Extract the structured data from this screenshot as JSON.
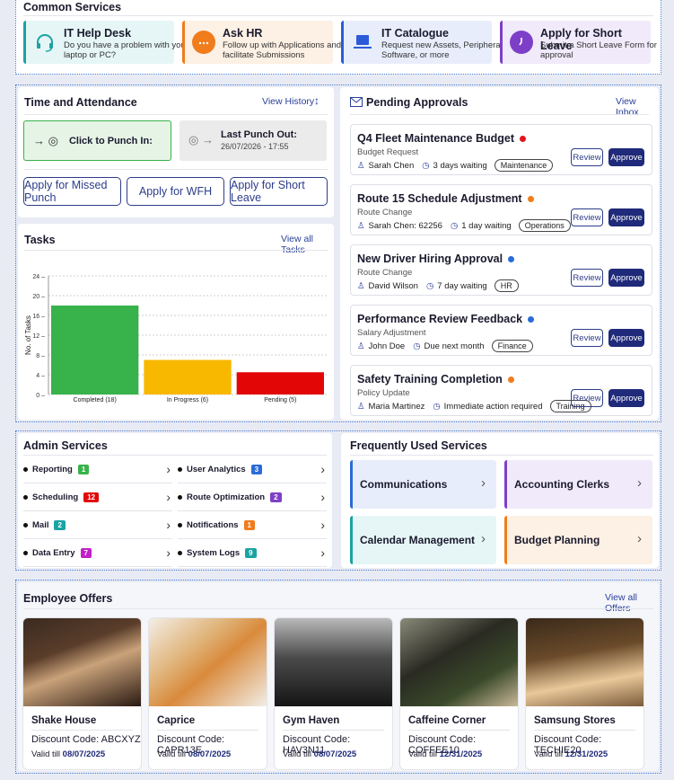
{
  "common_services": {
    "title": "Common Services",
    "items": [
      {
        "title": "IT Help Desk",
        "desc": "Do you have a problem with your laptop or PC?",
        "icon": "headset-icon",
        "color": "#1aa3a3",
        "bg": "#e6f6f6"
      },
      {
        "title": "Ask HR",
        "desc": "Follow up with Applications and facilitate Submissions",
        "icon": "chat-bubbles-icon",
        "color": "#f07c1c",
        "bg": "#fdf0e4"
      },
      {
        "title": "IT Catalogue",
        "desc": "Request new Assets, Peripherals, Software, or more",
        "icon": "laptop-icon",
        "color": "#2b5bd7",
        "bg": "#e7edfb"
      },
      {
        "title": "Apply for Short Leave",
        "desc": "Submit a Short Leave Form for approval",
        "icon": "clock-icon",
        "color": "#7e3fc8",
        "bg": "#f0eafa"
      }
    ]
  },
  "attendance": {
    "title": "Time and Attendance",
    "view_history": "View History",
    "punch_in": "Click to Punch In:",
    "last_punch_label": "Last Punch Out:",
    "last_punch_value": "26/07/2026 - 17:55",
    "buttons": [
      "Apply for Missed Punch",
      "Apply for WFH",
      "Apply for Short Leave"
    ]
  },
  "tasks": {
    "title": "Tasks",
    "view_all": "View all Tasks"
  },
  "chart_data": {
    "type": "bar",
    "categories": [
      "Completed (18)",
      "In Progress (6)",
      "Pending (5)"
    ],
    "values": [
      18,
      7,
      4.5
    ],
    "colors": [
      "#38b24a",
      "#f8b800",
      "#e30606"
    ],
    "ylabel": "No. of Tasks",
    "ylim": [
      0,
      24
    ],
    "yticks": [
      0,
      4,
      8,
      12,
      16,
      20,
      24
    ],
    "grid": true
  },
  "approvals": {
    "title": "Pending Approvals",
    "view_inbox": "View Inbox",
    "review_label": "Review",
    "approve_label": "Approve",
    "items": [
      {
        "title": "Q4 Fleet Maintenance Budget",
        "dot": "#e0141b",
        "subtitle": "Budget Request",
        "person": "Sarah Chen",
        "wait": "3 days waiting",
        "tag": "Maintenance"
      },
      {
        "title": "Route 15 Schedule Adjustment",
        "dot": "#f07c1c",
        "subtitle": "Route Change",
        "person": "Sarah Chen: 62256",
        "wait": "1 day waiting",
        "tag": "Operations"
      },
      {
        "title": "New Driver Hiring Approval",
        "dot": "#2b6bd7",
        "subtitle": "Route Change",
        "person": "David Wilson",
        "wait": "7 day waiting",
        "tag": "HR"
      },
      {
        "title": "Performance Review Feedback",
        "dot": "#2b6bd7",
        "subtitle": "Salary Adjustment",
        "person": "John Doe",
        "wait": "Due next month",
        "tag": "Finance"
      },
      {
        "title": "Safety Training Completion",
        "dot": "#f07c1c",
        "subtitle": "Policy Update",
        "person": "Maria Martinez",
        "wait": "Immediate action required",
        "tag": "Training"
      }
    ]
  },
  "admin": {
    "title": "Admin Services",
    "left": [
      {
        "label": "Reporting",
        "count": "1",
        "color": "#38b24a"
      },
      {
        "label": "Scheduling",
        "count": "12",
        "color": "#e30606"
      },
      {
        "label": "Mail",
        "count": "2",
        "color": "#1aa3a3"
      },
      {
        "label": "Data Entry",
        "count": "7",
        "color": "#c21fc8"
      }
    ],
    "right": [
      {
        "label": "User Analytics",
        "count": "3",
        "color": "#2b6bd7"
      },
      {
        "label": "Route Optimization",
        "count": "2",
        "color": "#7e3fc8"
      },
      {
        "label": "Notifications",
        "count": "1",
        "color": "#f07c1c"
      },
      {
        "label": "System Logs",
        "count": "9",
        "color": "#1aa3a3"
      }
    ]
  },
  "frequent": {
    "title": "Frequently Used Services",
    "items": [
      {
        "label": "Communications",
        "color": "#2b6bd7",
        "bg": "#e7edfb"
      },
      {
        "label": "Accounting Clerks",
        "color": "#7e3fc8",
        "bg": "#f0eafa"
      },
      {
        "label": "Calendar Management",
        "color": "#1aa3a3",
        "bg": "#e6f6f6"
      },
      {
        "label": "Budget Planning",
        "color": "#f07c1c",
        "bg": "#fdf0e4"
      }
    ]
  },
  "offers": {
    "title": "Employee Offers",
    "view_all": "View all Offers",
    "valid_prefix": "Valid till",
    "items": [
      {
        "name": "Shake House",
        "code": "Discount Code: ABCXYZ",
        "valid": "08/07/2025"
      },
      {
        "name": "Caprice",
        "code": "Discount Code: CAPR13E",
        "valid": "08/07/2025"
      },
      {
        "name": "Gym Haven",
        "code": "Discount Code: HAV3N11",
        "valid": "08/07/2025"
      },
      {
        "name": "Caffeine Corner",
        "code": "Discount Code: COFFEE10",
        "valid": "12/31/2025"
      },
      {
        "name": "Samsung Stores",
        "code": "Discount Code: TECHIE20",
        "valid": "12/31/2025"
      }
    ]
  }
}
